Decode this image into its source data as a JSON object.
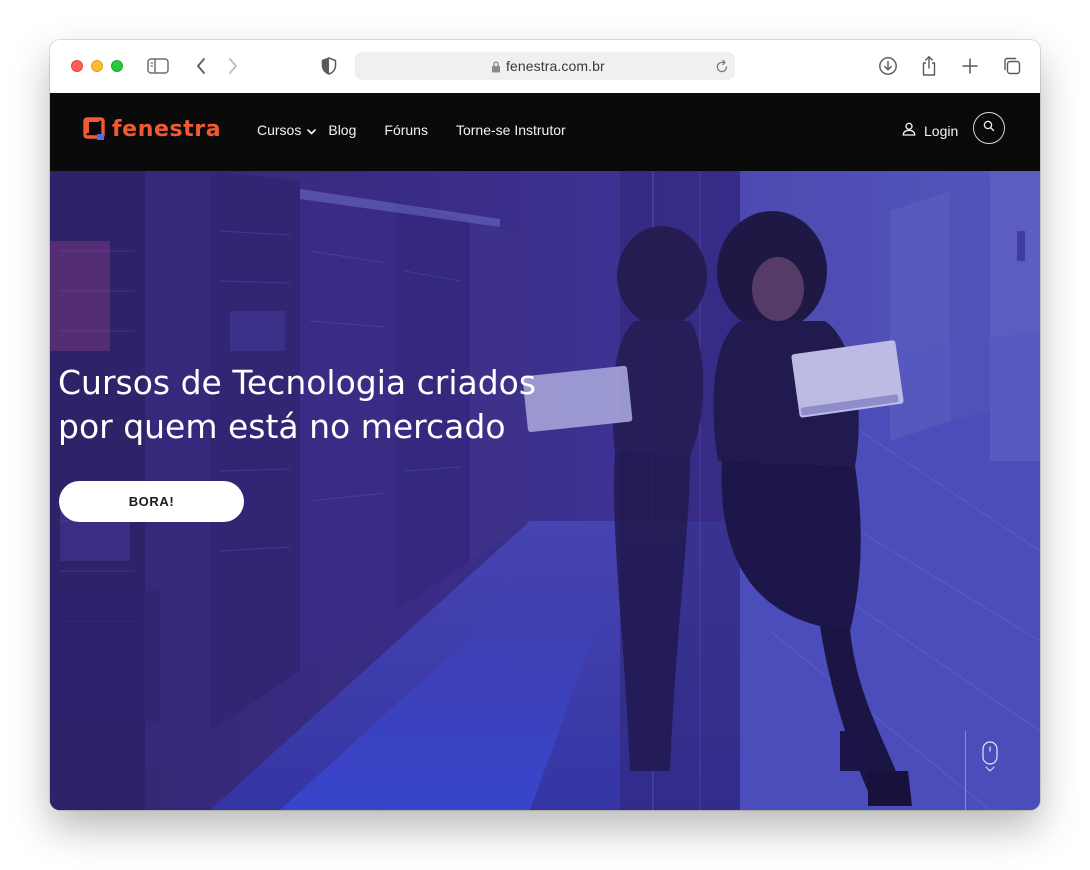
{
  "browser": {
    "url": "fenestra.com.br"
  },
  "site": {
    "logo_text": "fenestra",
    "nav": {
      "cursos": "Cursos",
      "blog": "Blog",
      "foruns": "Fóruns",
      "instrutor": "Torne-se Instrutor"
    },
    "login": "Login"
  },
  "hero": {
    "title_line1": "Cursos de Tecnologia criados",
    "title_line2": "por quem está no mercado",
    "cta": "BORA!"
  },
  "colors": {
    "brand_orange": "#ef5a35",
    "header_bg": "#0b0a0a",
    "hero_overlay": "#3c2f86"
  }
}
